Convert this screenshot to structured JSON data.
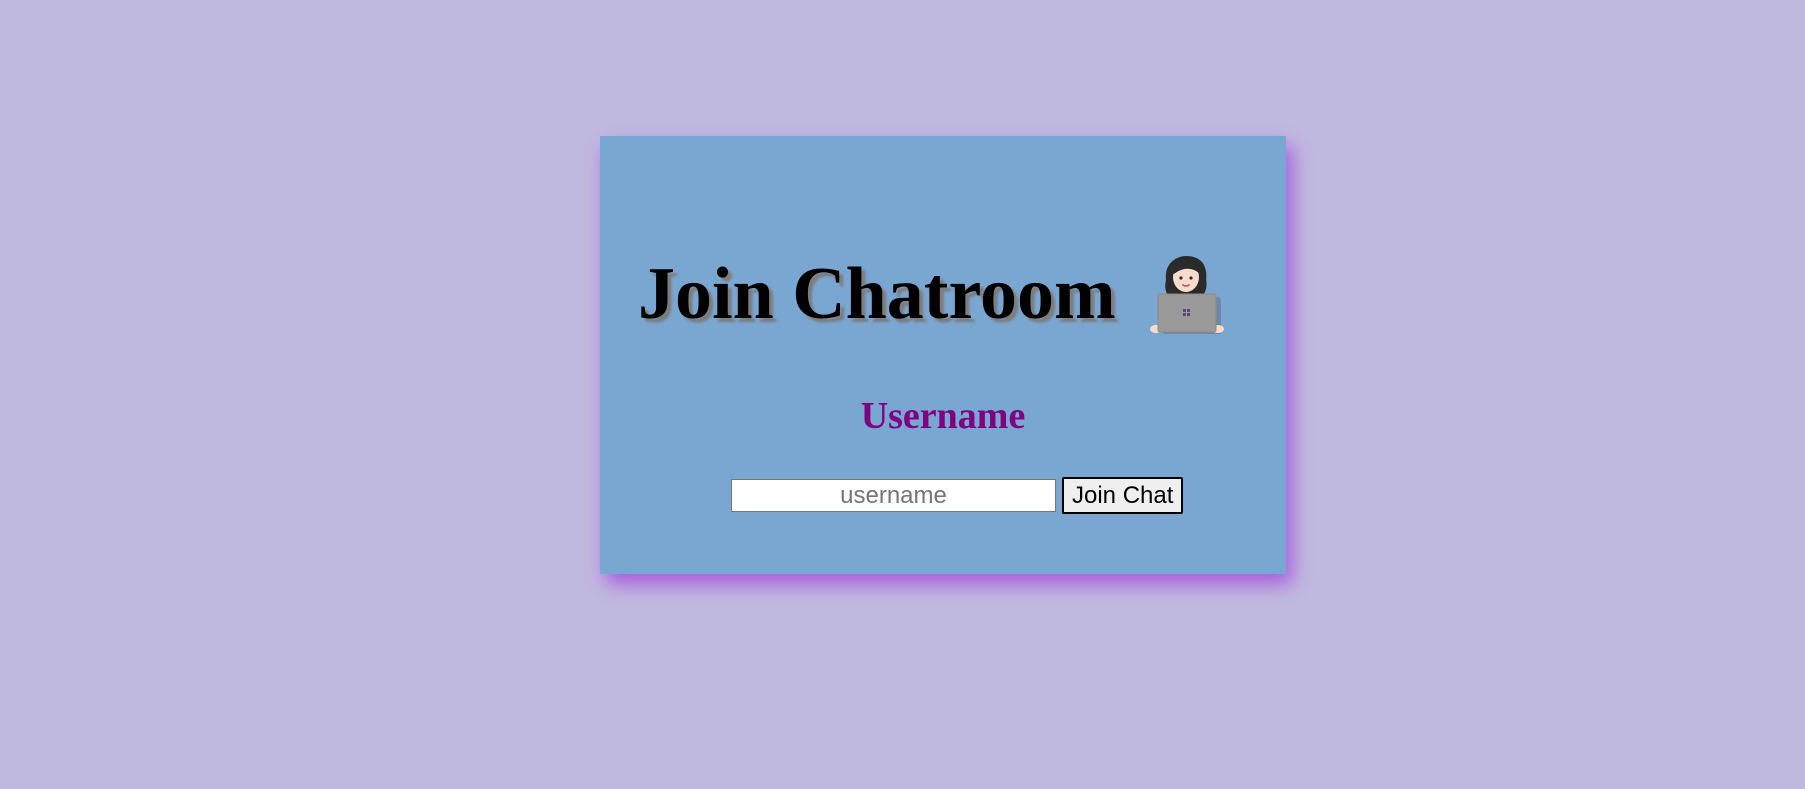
{
  "page": {
    "background_color": "#c0b9df"
  },
  "card": {
    "background_color": "#7aa6d2",
    "shadow_color": "#a03cdc",
    "title": "Join Chatroom",
    "title_icon": "woman-technologist-icon",
    "label": "Username",
    "label_color": "#800080",
    "username_input": {
      "placeholder": "username",
      "value": ""
    },
    "join_button_label": "Join Chat"
  }
}
